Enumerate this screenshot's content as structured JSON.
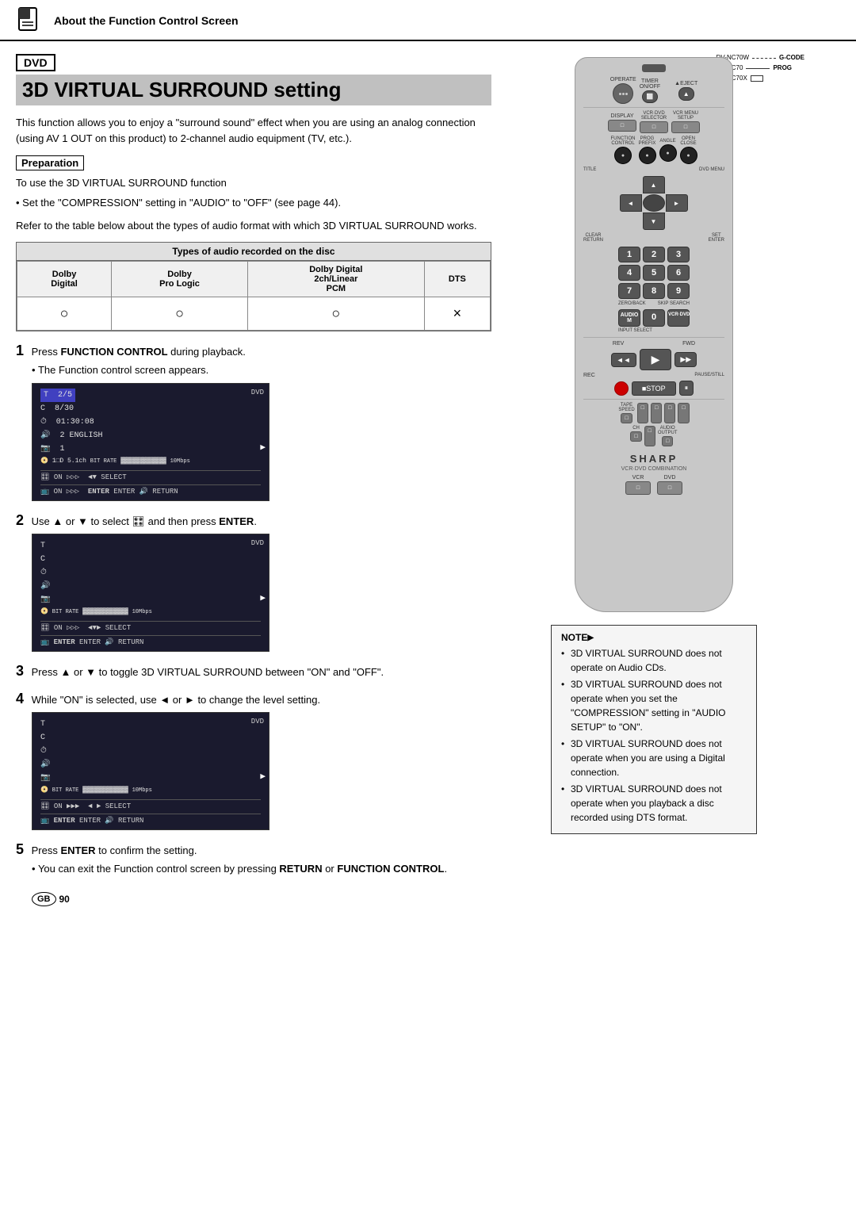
{
  "header": {
    "title": "About the Function Control Screen",
    "icon_alt": "document-icon"
  },
  "badge": {
    "label": "DVD"
  },
  "page_title": "3D VIRTUAL SURROUND setting",
  "intro": "This function allows you to enjoy a \"surround sound\" effect when you are using an analog connection (using AV 1 OUT on this product) to 2-channel audio equipment (TV, etc.).",
  "preparation": {
    "label": "Preparation",
    "line1": "To use the 3D VIRTUAL SURROUND function",
    "line2": "• Set the \"COMPRESSION\" setting in \"AUDIO\" to \"OFF\" (see page 44).",
    "line3": "Refer to the table below about the types of audio format with which 3D VIRTUAL SURROUND works."
  },
  "audio_table": {
    "header": "Types of audio recorded on the disc",
    "cols": [
      "Dolby\nDigital",
      "Dolby\nPro Logic",
      "Dolby Digital\n2ch/Linear\nPCM",
      "DTS"
    ],
    "values": [
      "○",
      "○",
      "○",
      "×"
    ]
  },
  "steps": [
    {
      "number": "1",
      "text": "Press ",
      "bold": "FUNCTION CONTROL",
      "text2": " during playback.",
      "bullet": "The Function control screen appears."
    },
    {
      "number": "2",
      "text": "Use ▲ or ▼ to select ",
      "icon": "🎛",
      "text2": " and then press ",
      "bold": "ENTER",
      "text3": "."
    },
    {
      "number": "3",
      "text": "Press ▲ or ▼ to toggle 3D VIRTUAL SURROUND between \"ON\" and \"OFF\"."
    },
    {
      "number": "4",
      "text": "While \"ON\" is selected, use ◄ or ► to change the level setting."
    },
    {
      "number": "5",
      "text": "Press ",
      "bold": "ENTER",
      "text2": " to confirm the setting.",
      "bullet": "You can exit the Function control screen by pressing ",
      "bold2": "RETURN",
      "text3": " or ",
      "bold3": "FUNCTION CONTROL",
      "text4": "."
    }
  ],
  "screen1": {
    "lines": [
      "T  2/5",
      "C  8/30",
      "⏱  01:30:08",
      "🔊  2  ENGLISH",
      "📷  1",
      "📀  1 □D  5.1ch  BIT RATE ▓▓▓▓▓▓▓▓▓▓▓  10Mbps",
      "🎛  ON  ▷▷▷  ◄ ▼ SELECT",
      "📺  ON  ▷▷▷  ENTER ENTER 🔊 RETURN"
    ],
    "label": "DVD"
  },
  "screen2": {
    "lines": [
      "T",
      "C",
      "⏱",
      "🔊",
      "📷",
      "📀  BIT RATE ▓▓▓▓▓▓▓▓▓▓▓  10Mbps",
      "🎛  ON  ▷▷▷  ◄ ▼ ► SELECT",
      "📺  ENTER ENTER 🔊 RETURN"
    ],
    "label": "DVD"
  },
  "screen3": {
    "lines": [
      "T",
      "C",
      "⏱",
      "🔊",
      "📷",
      "📀  BIT RATE ▓▓▓▓▓▓▓▓▓▓▓  10Mbps",
      "🎛  ON  ▶▶▶  ◄ ► SELECT",
      "📺  ENTER ENTER 🔊 RETURN"
    ],
    "label": "DVD"
  },
  "note": {
    "header": "NOTE",
    "items": [
      "3D VIRTUAL SURROUND does not operate on Audio CDs.",
      "3D VIRTUAL SURROUND does not operate when you set the \"COMPRESSION\" setting in \"AUDIO SETUP\" to \"ON\".",
      "3D VIRTUAL SURROUND does not operate when you are using a Digital connection.",
      "3D VIRTUAL SURROUND does not operate when you playback a disc recorded using DTS format."
    ]
  },
  "footer": {
    "label": "GB",
    "number": "90"
  },
  "remote": {
    "model_labels": [
      "DV-NC70W",
      "DV-NC70",
      "DV-NC70X"
    ],
    "model_codes": [
      "G-CODE",
      "PROG",
      ""
    ],
    "brand": "SHARP",
    "subtitle": "VCR·DVD COMBINATION",
    "buttons": {
      "operate": "OPERATE",
      "timer": "TIMER\nON/OFF",
      "eject": "▲EJECT",
      "display": "DISPLAY",
      "vcr_dvd": "VCR·DVD\nSELECTOR",
      "vcr_menu": "VCR MENU\nSETUP",
      "function_control": "FUNCTION\nCONTROL",
      "prog": "PROG\nPREFIX",
      "angle": "ANGLE",
      "open_close": "OPEN\nCLOSE",
      "title": "TITLE",
      "dvd_menu": "DVD MENU",
      "clear_return": "CLEAR\nRETURN",
      "set_enter": "SET\nENTER",
      "zero_back": "ZERO/BACK",
      "skip_search": "SKIP SEARCH",
      "audio_m": "AUDIO M",
      "input_select": "INPUT SELECT",
      "vcr_dvd2": "VCR·DVD",
      "rev": "REV",
      "fwd": "FWD",
      "play": "▶ PLAY",
      "rec": "REC",
      "stop": "■STOP",
      "pause_still": "PAUSE/STILL",
      "tape_speed": "TAPE\nSPEED",
      "ch": "CH",
      "audio_output": "AUDIO\nOUTPUT",
      "vcr": "VCR",
      "dvd": "DVD"
    }
  }
}
